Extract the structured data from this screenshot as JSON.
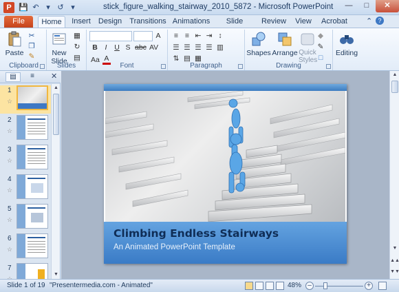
{
  "window": {
    "title": "stick_figure_walking_stairway_2010_5872 - Microsoft PowerPoint",
    "app_letter": "P"
  },
  "tabs": [
    "File",
    "Home",
    "Insert",
    "Design",
    "Transitions",
    "Animations",
    "Slide Show",
    "Review",
    "View",
    "Acrobat"
  ],
  "active_tab": "Home",
  "ribbon": {
    "clipboard": {
      "label": "Clipboard",
      "paste": "Paste"
    },
    "slides": {
      "label": "Slides",
      "new_slide": "New Slide"
    },
    "font": {
      "label": "Font"
    },
    "paragraph": {
      "label": "Paragraph"
    },
    "drawing": {
      "label": "Drawing",
      "shapes": "Shapes",
      "arrange": "Arrange",
      "quick_styles": "Quick Styles"
    },
    "editing": {
      "label": "Editing"
    }
  },
  "slide_panel": {
    "thumbnails": [
      {
        "num": "1",
        "selected": true
      },
      {
        "num": "2",
        "selected": false
      },
      {
        "num": "3",
        "selected": false
      },
      {
        "num": "4",
        "selected": false
      },
      {
        "num": "5",
        "selected": false
      },
      {
        "num": "6",
        "selected": false
      },
      {
        "num": "7",
        "selected": false
      }
    ]
  },
  "slide": {
    "title": "Climbing Endless Stairways",
    "subtitle": "An Animated PowerPoint Template"
  },
  "status": {
    "slide_info": "Slide 1 of 19",
    "theme": "\"Presentermedia.com - Animated\"",
    "zoom": "48%",
    "zoom_value": 48
  },
  "colors": {
    "file_tab": "#c5431b",
    "slide_band": "#3a7bc6",
    "title_text": "#0f2d56"
  }
}
